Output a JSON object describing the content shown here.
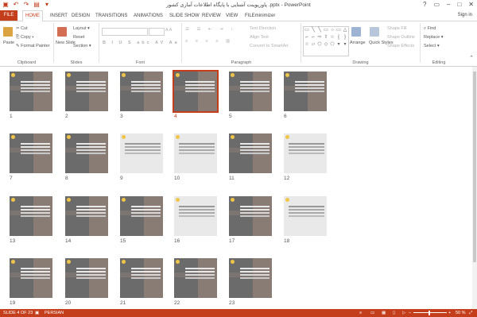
{
  "app": {
    "title": "پاورپوینت آشنایی با پایگاه اطلاعات آماری کشور .pptx - PowerPoint",
    "signin": "Sign in",
    "help": "?"
  },
  "tabs": [
    "FILE",
    "HOME",
    "INSERT",
    "DESIGN",
    "TRANSITIONS",
    "ANIMATIONS",
    "SLIDE SHOW",
    "REVIEW",
    "VIEW",
    "FILEminimizer"
  ],
  "ribbon": {
    "clipboard": {
      "label": "Clipboard",
      "paste": "Paste",
      "cut": "Cut",
      "copy": "Copy",
      "format_painter": "Format Painter"
    },
    "slides": {
      "label": "Slides",
      "new_slide": "New Slide",
      "layout": "Layout",
      "reset": "Reset",
      "section": "Section"
    },
    "font": {
      "label": "Font"
    },
    "paragraph": {
      "label": "Paragraph",
      "text_direction": "Text Direction",
      "align_text": "Align Text",
      "convert": "Convert to SmartArt"
    },
    "drawing": {
      "label": "Drawing",
      "arrange": "Arrange",
      "quick_styles": "Quick Styles",
      "shape_fill": "Shape Fill",
      "shape_outline": "Shape Outline",
      "shape_effects": "Shape Effects"
    },
    "editing": {
      "label": "Editing",
      "find": "Find",
      "replace": "Replace",
      "select": "Select"
    }
  },
  "slides": [
    {
      "num": "1",
      "type": "dark"
    },
    {
      "num": "2",
      "type": "dark"
    },
    {
      "num": "3",
      "type": "dark"
    },
    {
      "num": "4",
      "type": "dark",
      "selected": true
    },
    {
      "num": "5",
      "type": "dark"
    },
    {
      "num": "6",
      "type": "dark"
    },
    {
      "num": "7",
      "type": "dark"
    },
    {
      "num": "8",
      "type": "dark"
    },
    {
      "num": "9",
      "type": "light"
    },
    {
      "num": "10",
      "type": "light"
    },
    {
      "num": "11",
      "type": "dark"
    },
    {
      "num": "12",
      "type": "light"
    },
    {
      "num": "13",
      "type": "dark"
    },
    {
      "num": "14",
      "type": "dark"
    },
    {
      "num": "15",
      "type": "dark"
    },
    {
      "num": "16",
      "type": "light"
    },
    {
      "num": "17",
      "type": "dark"
    },
    {
      "num": "18",
      "type": "light"
    },
    {
      "num": "19",
      "type": "dark"
    },
    {
      "num": "20",
      "type": "dark"
    },
    {
      "num": "21",
      "type": "dark"
    },
    {
      "num": "22",
      "type": "dark"
    },
    {
      "num": "23",
      "type": "dark"
    }
  ],
  "status": {
    "slide": "SLIDE 4 OF 23",
    "language": "PERSIAN",
    "zoom": "50 %"
  },
  "colors": {
    "accent": "#c43e1c"
  }
}
